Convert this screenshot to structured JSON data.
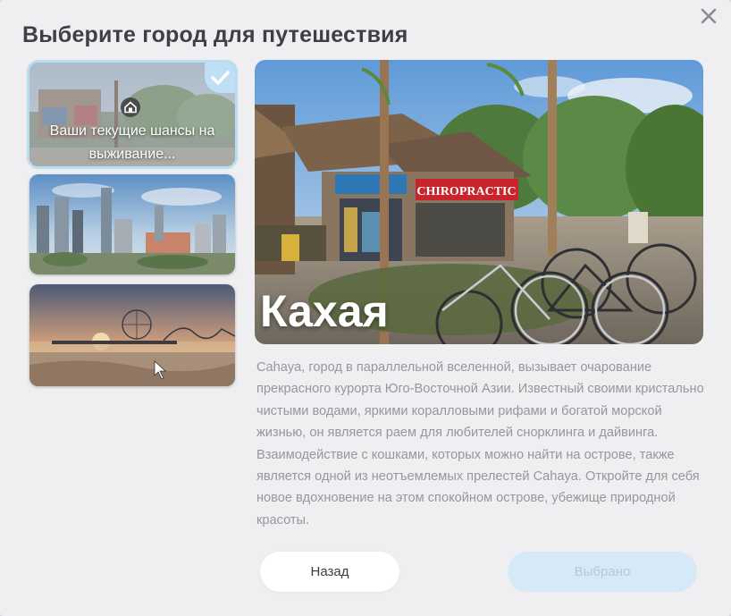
{
  "dialog": {
    "title": "Выберите город для путешествия",
    "close_icon": "close-icon"
  },
  "cities": [
    {
      "label": "Ваши текущие шансы на\nвыживание...",
      "selected": true
    },
    {
      "label": "",
      "selected": false
    },
    {
      "label": "",
      "selected": false
    }
  ],
  "thumb_label_text": "Ваши текущие шансы на выживание...",
  "hero": {
    "city_name": "Кахая",
    "sign_text": "CHIROPRACTIC"
  },
  "description": "Cahaya, город в параллельной вселенной, вызывает очарование прекрасного курорта Юго-Восточной Азии. Известный своими кристально чистыми водами, яркими коралловыми рифами и богатой морской жизнью, он является раем для любителей снорклинга и дайвинга. Взаимодействие с кошками, которых можно найти на острове, также является одной из неотъемлемых прелестей Cahaya. Откройте для себя новое вдохновение на этом спокойном острове, убежище природной красоты.",
  "buttons": {
    "back_label": "Назад",
    "selected_label": "Выбрано"
  },
  "colors": {
    "accent": "#bfe0f4",
    "selected_button": "#d6e9f6",
    "text": "#3f3f44",
    "description_text": "#97979c"
  }
}
